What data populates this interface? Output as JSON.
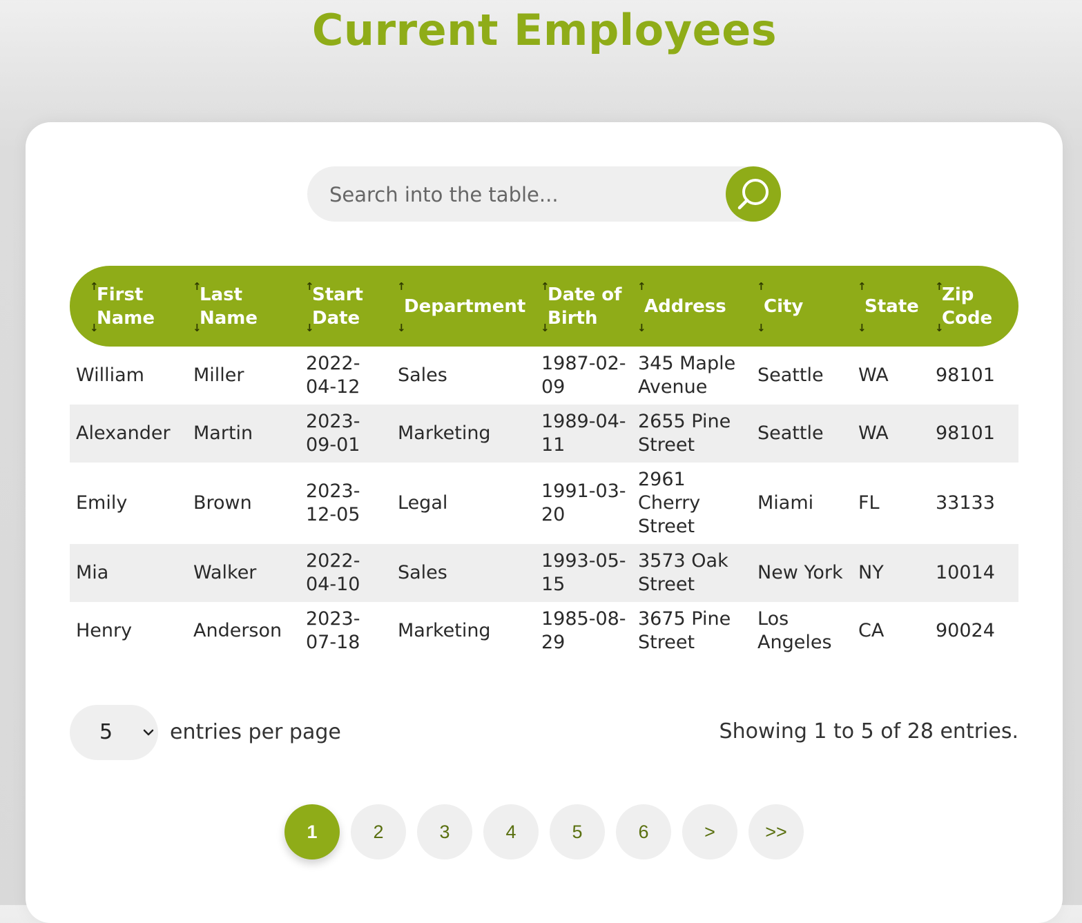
{
  "page": {
    "title": "Current Employees",
    "accent_color": "#8fac18"
  },
  "search": {
    "placeholder": "Search into the table...",
    "value": "",
    "icon": "search-icon"
  },
  "table": {
    "columns": [
      {
        "key": "first_name",
        "label": "First Name"
      },
      {
        "key": "last_name",
        "label": "Last Name"
      },
      {
        "key": "start_date",
        "label": "Start Date"
      },
      {
        "key": "department",
        "label": "Department"
      },
      {
        "key": "date_of_birth",
        "label": "Date of Birth"
      },
      {
        "key": "address",
        "label": "Address"
      },
      {
        "key": "city",
        "label": "City"
      },
      {
        "key": "state",
        "label": "State"
      },
      {
        "key": "zip_code",
        "label": "Zip Code"
      }
    ],
    "sort_icons": {
      "up": "↑",
      "down": "↓"
    },
    "rows": [
      {
        "first_name": "William",
        "last_name": "Miller",
        "start_date": "2022-04-12",
        "department": "Sales",
        "date_of_birth": "1987-02-09",
        "address": "345 Maple Avenue",
        "city": "Seattle",
        "state": "WA",
        "zip_code": "98101"
      },
      {
        "first_name": "Alexander",
        "last_name": "Martin",
        "start_date": "2023-09-01",
        "department": "Marketing",
        "date_of_birth": "1989-04-11",
        "address": "2655 Pine Street",
        "city": "Seattle",
        "state": "WA",
        "zip_code": "98101"
      },
      {
        "first_name": "Emily",
        "last_name": "Brown",
        "start_date": "2023-12-05",
        "department": "Legal",
        "date_of_birth": "1991-03-20",
        "address": "2961 Cherry Street",
        "city": "Miami",
        "state": "FL",
        "zip_code": "33133"
      },
      {
        "first_name": "Mia",
        "last_name": "Walker",
        "start_date": "2022-04-10",
        "department": "Sales",
        "date_of_birth": "1993-05-15",
        "address": "3573 Oak Street",
        "city": "New York",
        "state": "NY",
        "zip_code": "10014"
      },
      {
        "first_name": "Henry",
        "last_name": "Anderson",
        "start_date": "2023-07-18",
        "department": "Marketing",
        "date_of_birth": "1985-08-29",
        "address": "3675 Pine Street",
        "city": "Los Angeles",
        "state": "CA",
        "zip_code": "90024"
      }
    ]
  },
  "footer": {
    "entries_per_page": {
      "selected": "5",
      "label": "entries per page"
    },
    "showing_text": "Showing 1 to 5 of 28 entries."
  },
  "pagination": {
    "current_page": 1,
    "pages": [
      "1",
      "2",
      "3",
      "4",
      "5",
      "6"
    ],
    "next_label": ">",
    "last_label": ">>"
  }
}
